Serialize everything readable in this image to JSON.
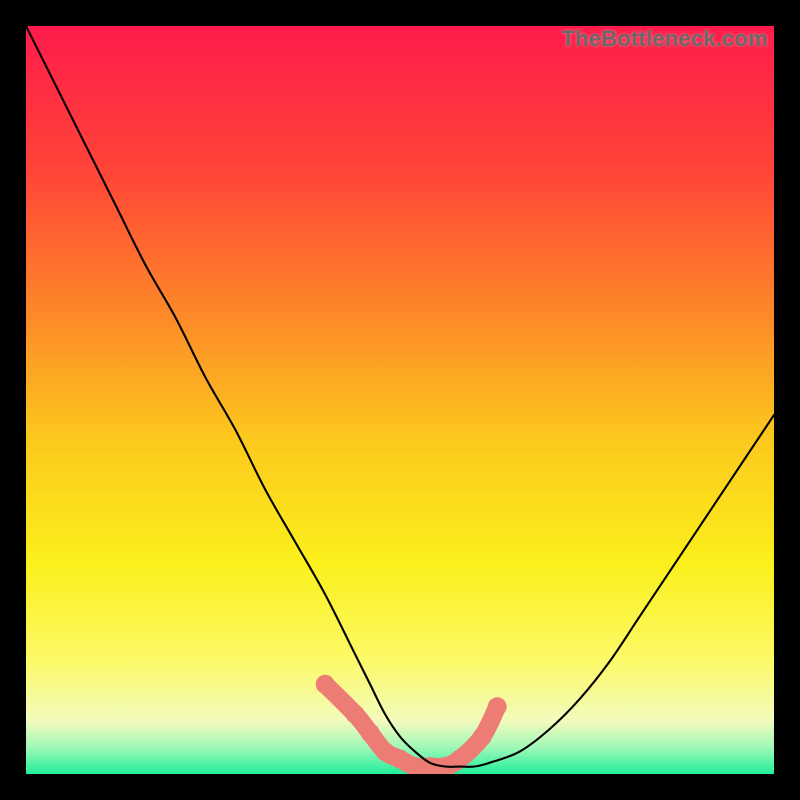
{
  "watermark": "TheBottleneck.com",
  "chart_data": {
    "type": "line",
    "title": "",
    "xlabel": "",
    "ylabel": "",
    "xlim": [
      0,
      100
    ],
    "ylim": [
      0,
      100
    ],
    "background_gradient": {
      "stops": [
        {
          "offset": 0.0,
          "color": "#ff1b4b"
        },
        {
          "offset": 0.2,
          "color": "#ff4637"
        },
        {
          "offset": 0.4,
          "color": "#fd8e27"
        },
        {
          "offset": 0.55,
          "color": "#fcc81d"
        },
        {
          "offset": 0.72,
          "color": "#fbf01c"
        },
        {
          "offset": 0.85,
          "color": "#fcfa69"
        },
        {
          "offset": 0.93,
          "color": "#f2fbbd"
        },
        {
          "offset": 0.965,
          "color": "#9df8b8"
        },
        {
          "offset": 1.0,
          "color": "#22ee9a"
        }
      ]
    },
    "series": [
      {
        "name": "black-curve",
        "color": "#000000",
        "width": 2.1,
        "x": [
          0,
          4,
          8,
          12,
          16,
          20,
          24,
          28,
          32,
          36,
          40,
          44,
          46,
          48,
          50,
          52,
          54,
          56,
          58,
          60,
          62,
          66,
          70,
          74,
          78,
          82,
          86,
          90,
          94,
          98,
          100
        ],
        "values": [
          100,
          92,
          84,
          76,
          68,
          61,
          53,
          46,
          38,
          31,
          24,
          16,
          12,
          8,
          5,
          3,
          1.5,
          1,
          1,
          1,
          1.5,
          3,
          6,
          10,
          15,
          21,
          27,
          33,
          39,
          45,
          48
        ]
      },
      {
        "name": "marker-band",
        "color": "#ed7d74",
        "type": "band",
        "x": [
          40,
          44,
          46,
          48,
          50,
          52,
          54,
          56,
          58,
          61,
          63
        ],
        "values": [
          12,
          8,
          5.5,
          3,
          2,
          1,
          1,
          1,
          2,
          5,
          9
        ],
        "radius": 9
      }
    ]
  }
}
